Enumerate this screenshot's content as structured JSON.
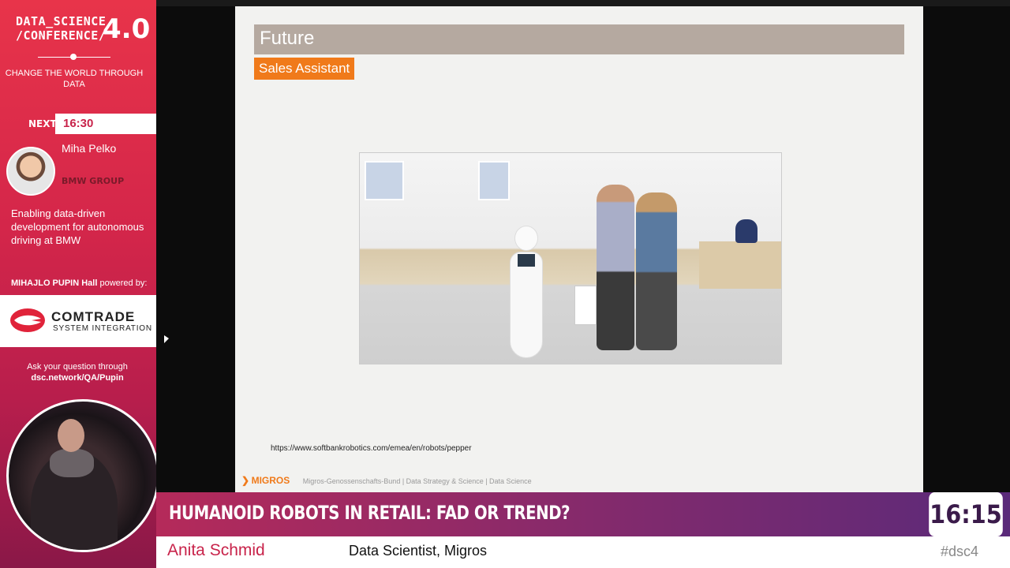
{
  "conference": {
    "line1": "DATA_SCIENCE",
    "line2": "/CONFERENCE/",
    "version": "4.0",
    "tagline": "CHANGE THE WORLD THROUGH DATA"
  },
  "next": {
    "label": "NEXT:",
    "time": "16:30",
    "speaker": "Miha Pelko",
    "org": "BMW GROUP",
    "talk": "Enabling data-driven development for autonomous driving at BMW"
  },
  "hall": {
    "name": "MIHAJLO PUPIN Hall",
    "powered": "powered by:"
  },
  "sponsor": {
    "name": "COMTRADE",
    "subtitle": "SYSTEM INTEGRATION"
  },
  "ask": {
    "line1": "Ask your question through",
    "link": "dsc.network/QA/Pupin"
  },
  "slide": {
    "title": "Future",
    "tag": "Sales Assistant",
    "url": "https://www.softbankrobotics.com/emea/en/robots/pepper",
    "footer_brand": "MIGROS",
    "footer_text": "Migros-Genossenschafts-Bund | Data Strategy & Science | Data Science"
  },
  "talk": {
    "title": "HUMANOID ROBOTS IN RETAIL: FAD OR TREND?",
    "clock": "16:15"
  },
  "presenter": {
    "name": "Anita Schmid",
    "role": "Data Scientist, Migros",
    "hashtag": "#dsc4"
  },
  "colors": {
    "accent": "#d4264a",
    "orange": "#f07a1a",
    "purple": "#5a2a7a"
  }
}
